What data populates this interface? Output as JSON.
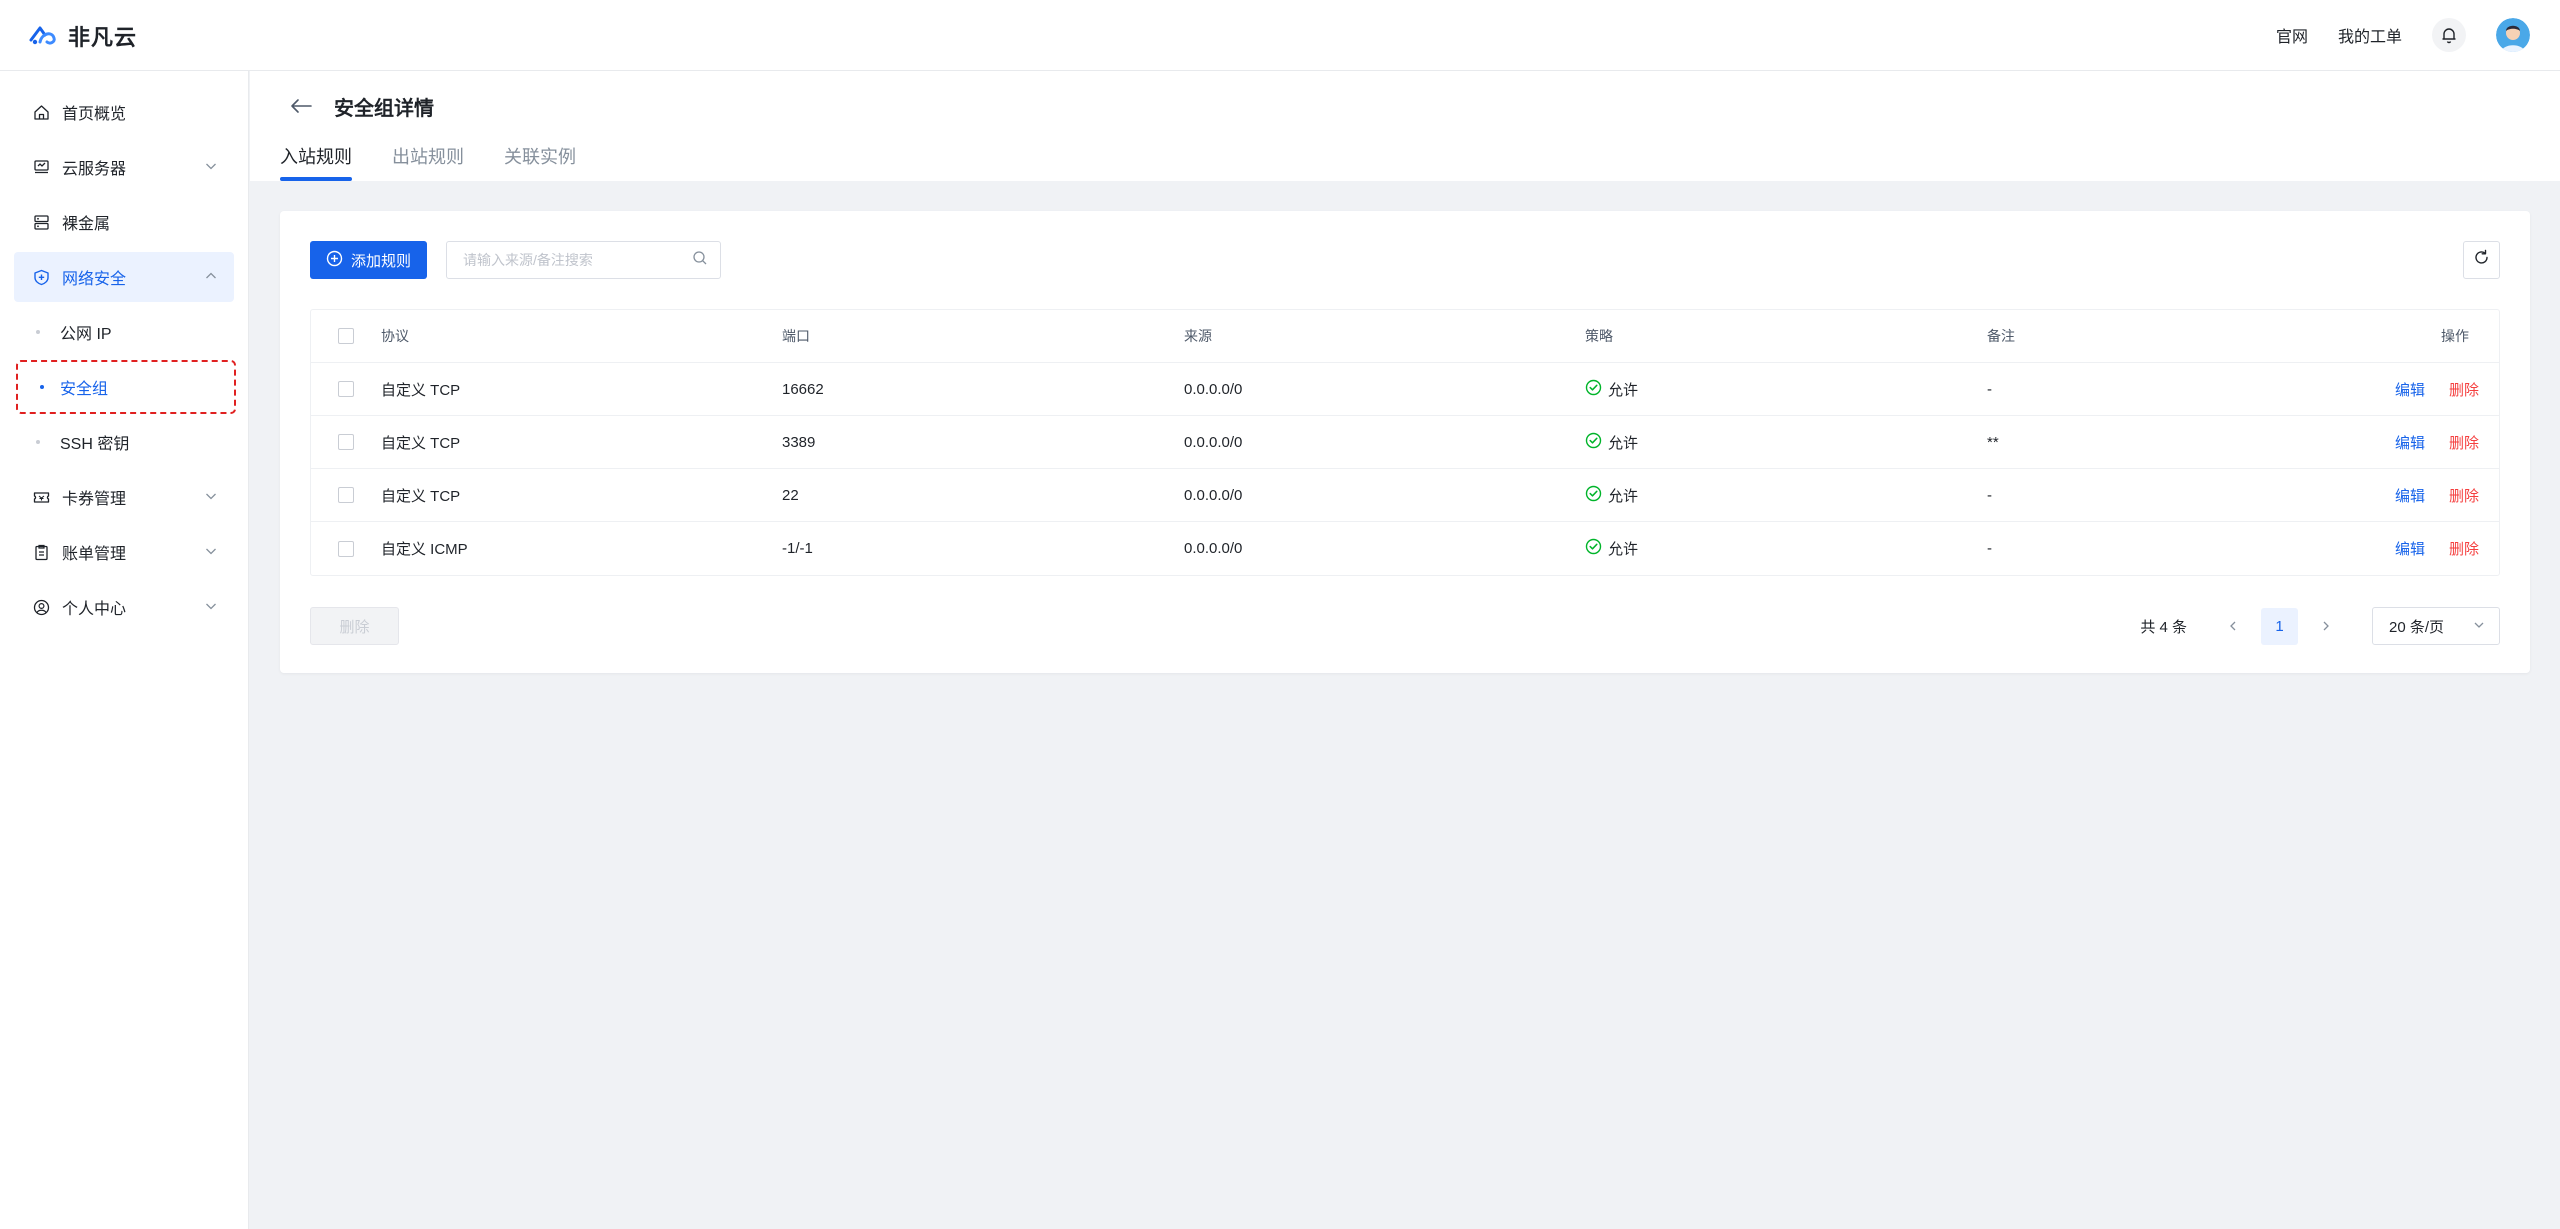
{
  "app": {
    "brand_name": "非凡云"
  },
  "header": {
    "links": [
      "官网",
      "我的工单"
    ]
  },
  "sidebar": {
    "items": [
      {
        "label": "首页概览",
        "icon": "home-icon",
        "has_arrow": false
      },
      {
        "label": "云服务器",
        "icon": "server-icon",
        "has_arrow": true
      },
      {
        "label": "裸金属",
        "icon": "baremetal-icon",
        "has_arrow": false
      },
      {
        "label": "网络安全",
        "icon": "shield-icon",
        "has_arrow": true,
        "open": true
      },
      {
        "label": "卡券管理",
        "icon": "ticket-icon",
        "has_arrow": true
      },
      {
        "label": "账单管理",
        "icon": "bill-icon",
        "has_arrow": true
      },
      {
        "label": "个人中心",
        "icon": "user-icon",
        "has_arrow": true
      }
    ],
    "subitems": [
      "公网 IP",
      "安全组",
      "SSH 密钥"
    ]
  },
  "page": {
    "title": "安全组详情",
    "tabs": [
      "入站规则",
      "出站规则",
      "关联实例"
    ]
  },
  "toolbar": {
    "add_label": "添加规则",
    "search_placeholder": "请输入来源/备注搜索"
  },
  "table": {
    "columns": [
      "协议",
      "端口",
      "来源",
      "策略",
      "备注",
      "操作"
    ],
    "rows": [
      {
        "protocol": "自定义 TCP",
        "port": "16662",
        "source": "0.0.0.0/0",
        "policy": "允许",
        "remark": "-"
      },
      {
        "protocol": "自定义 TCP",
        "port": "3389",
        "source": "0.0.0.0/0",
        "policy": "允许",
        "remark": "**"
      },
      {
        "protocol": "自定义 TCP",
        "port": "22",
        "source": "0.0.0.0/0",
        "policy": "允许",
        "remark": "-"
      },
      {
        "protocol": "自定义 ICMP",
        "port": "-1/-1",
        "source": "0.0.0.0/0",
        "policy": "允许",
        "remark": "-"
      }
    ],
    "edit_label": "编辑",
    "delete_label": "删除"
  },
  "footer": {
    "bulk_delete_label": "删除",
    "total_label": "共 4 条",
    "current_page": "1",
    "page_size_label": "20 条/页"
  },
  "colors": {
    "primary": "#1763ea",
    "danger": "#f53f3f",
    "success": "#00b42a",
    "highlight_outline": "#e02020"
  }
}
